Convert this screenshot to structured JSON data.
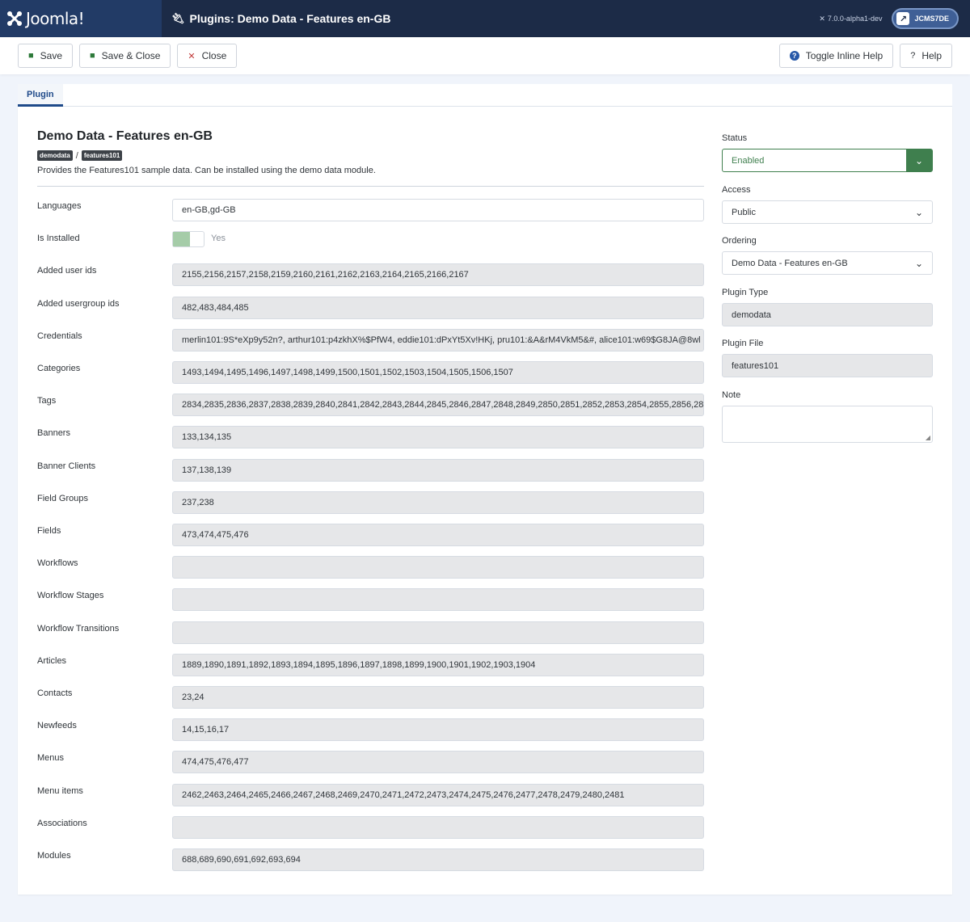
{
  "header": {
    "brand": "Joomla!",
    "title": "Plugins: Demo Data - Features en-GB",
    "version": "7.0.0-alpha1-dev",
    "site_label": "JCMS7DE"
  },
  "toolbar": {
    "save": "Save",
    "save_close": "Save & Close",
    "close": "Close",
    "toggle_help": "Toggle Inline Help",
    "help": "Help"
  },
  "tabs": [
    {
      "label": "Plugin"
    }
  ],
  "plugin": {
    "title": "Demo Data - Features en-GB",
    "badge_folder": "demodata",
    "badge_element": "features101",
    "description": "Provides the Features101 sample data. Can be installed using the demo data module."
  },
  "fields": [
    {
      "label": "Languages",
      "value": "en-GB,gd-GB"
    },
    {
      "label": "Is Installed",
      "value": "Yes"
    },
    {
      "label": "Added user ids",
      "value": "2155,2156,2157,2158,2159,2160,2161,2162,2163,2164,2165,2166,2167"
    },
    {
      "label": "Added usergroup ids",
      "value": "482,483,484,485"
    },
    {
      "label": "Credentials",
      "value": "merlin101:9S*eXp9y52n?, arthur101:p4zkhX%$PfW4, eddie101:dPxYt5Xv!HKj, pru101:&A&rM4VkM5&#, alice101:w69$G8JA@8wl"
    },
    {
      "label": "Categories",
      "value": "1493,1494,1495,1496,1497,1498,1499,1500,1501,1502,1503,1504,1505,1506,1507"
    },
    {
      "label": "Tags",
      "value": "2834,2835,2836,2837,2838,2839,2840,2841,2842,2843,2844,2845,2846,2847,2848,2849,2850,2851,2852,2853,2854,2855,2856,28"
    },
    {
      "label": "Banners",
      "value": "133,134,135"
    },
    {
      "label": "Banner Clients",
      "value": "137,138,139"
    },
    {
      "label": "Field Groups",
      "value": "237,238"
    },
    {
      "label": "Fields",
      "value": "473,474,475,476"
    },
    {
      "label": "Workflows",
      "value": ""
    },
    {
      "label": "Workflow Stages",
      "value": ""
    },
    {
      "label": "Workflow Transitions",
      "value": ""
    },
    {
      "label": "Articles",
      "value": "1889,1890,1891,1892,1893,1894,1895,1896,1897,1898,1899,1900,1901,1902,1903,1904"
    },
    {
      "label": "Contacts",
      "value": "23,24"
    },
    {
      "label": "Newfeeds",
      "value": "14,15,16,17"
    },
    {
      "label": "Menus",
      "value": "474,475,476,477"
    },
    {
      "label": "Menu items",
      "value": "2462,2463,2464,2465,2466,2467,2468,2469,2470,2471,2472,2473,2474,2475,2476,2477,2478,2479,2480,2481"
    },
    {
      "label": "Associations",
      "value": ""
    },
    {
      "label": "Modules",
      "value": "688,689,690,691,692,693,694"
    }
  ],
  "side": {
    "status_label": "Status",
    "status_value": "Enabled",
    "access_label": "Access",
    "access_value": "Public",
    "ordering_label": "Ordering",
    "ordering_value": "Demo Data - Features en-GB",
    "type_label": "Plugin Type",
    "type_value": "demodata",
    "file_label": "Plugin File",
    "file_value": "features101",
    "note_label": "Note",
    "note_value": ""
  },
  "colors": {
    "header_bg": "#1c2b47",
    "brand_bg": "#223b66",
    "status_green": "#3f7f4e",
    "tab_blue": "#1f4a8a"
  }
}
